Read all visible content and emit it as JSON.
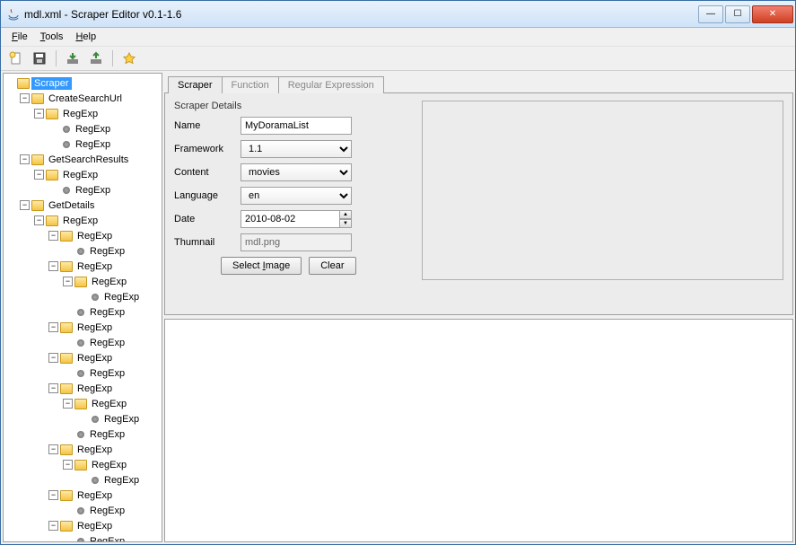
{
  "title": "mdl.xml - Scraper Editor v0.1-1.6",
  "menu": {
    "file": "File",
    "tools": "Tools",
    "help": "Help"
  },
  "tabs": {
    "scraper": "Scraper",
    "function": "Function",
    "regex": "Regular Expression"
  },
  "details": {
    "title": "Scraper Details",
    "name_label": "Name",
    "name_value": "MyDoramaList",
    "framework_label": "Framework",
    "framework_value": "1.1",
    "content_label": "Content",
    "content_value": "movies",
    "language_label": "Language",
    "language_value": "en",
    "date_label": "Date",
    "date_value": "2010-08-02",
    "thumbnail_label": "Thumnail",
    "thumbnail_value": "mdl.png",
    "select_image": "Select Image",
    "clear": "Clear"
  },
  "tree": {
    "root": "Scraper",
    "create_search_url": "CreateSearchUrl",
    "get_search_results": "GetSearchResults",
    "get_details": "GetDetails",
    "regexp": "RegExp"
  }
}
